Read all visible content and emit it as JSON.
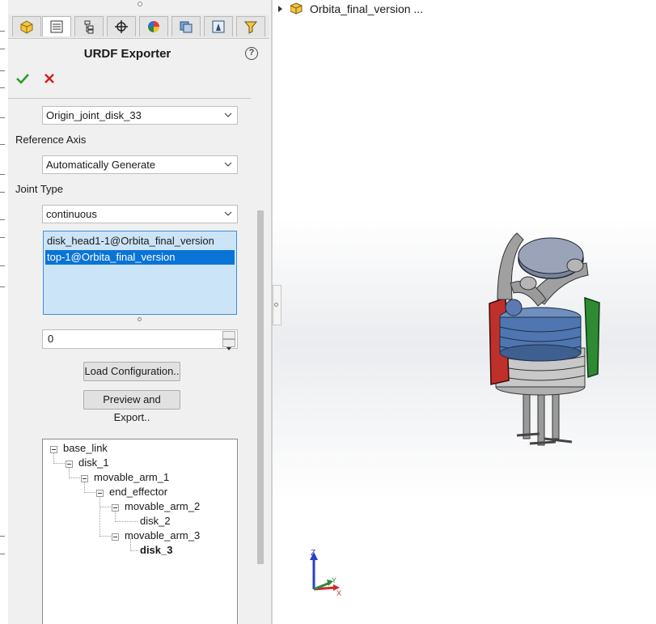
{
  "panel": {
    "title": "URDF Exporter",
    "help_icon": "?",
    "tabs": [
      "feature-manager-icon",
      "property-manager-icon",
      "configuration-manager-icon",
      "dimxpert-icon",
      "display-manager-icon",
      "cam-icon",
      "motion-icon",
      "filter-icon"
    ]
  },
  "form": {
    "coordinate_select": "Origin_joint_disk_33",
    "reference_axis_label": "Reference Axis",
    "reference_axis_select": "Automatically Generate",
    "joint_type_label": "Joint Type",
    "joint_type_select": "continuous",
    "components": [
      "disk_head1-1@Orbita_final_version",
      "top-1@Orbita_final_version"
    ],
    "selected_component_index": 1,
    "limit_value": "0",
    "load_button": "Load Configuration..",
    "export_button": "Preview and Export.."
  },
  "tree": {
    "nodes": [
      {
        "label": "base_link",
        "depth": 0,
        "expandable": true,
        "bold": false
      },
      {
        "label": "disk_1",
        "depth": 1,
        "expandable": true,
        "bold": false
      },
      {
        "label": "movable_arm_1",
        "depth": 2,
        "expandable": true,
        "bold": false
      },
      {
        "label": "end_effector",
        "depth": 3,
        "expandable": true,
        "bold": false
      },
      {
        "label": "movable_arm_2",
        "depth": 4,
        "expandable": true,
        "bold": false
      },
      {
        "label": "disk_2",
        "depth": 5,
        "expandable": false,
        "bold": false
      },
      {
        "label": "movable_arm_3",
        "depth": 4,
        "expandable": true,
        "bold": false
      },
      {
        "label": "disk_3",
        "depth": 5,
        "expandable": false,
        "bold": true
      }
    ]
  },
  "viewport": {
    "model_name": "Orbita_final_version ...",
    "triad": {
      "z": "Z",
      "y": "Y",
      "x": "X"
    }
  },
  "colors": {
    "accent_blue": "#0a74d6",
    "ok_green": "#2f9a2f",
    "cancel_red": "#d21e1e"
  }
}
